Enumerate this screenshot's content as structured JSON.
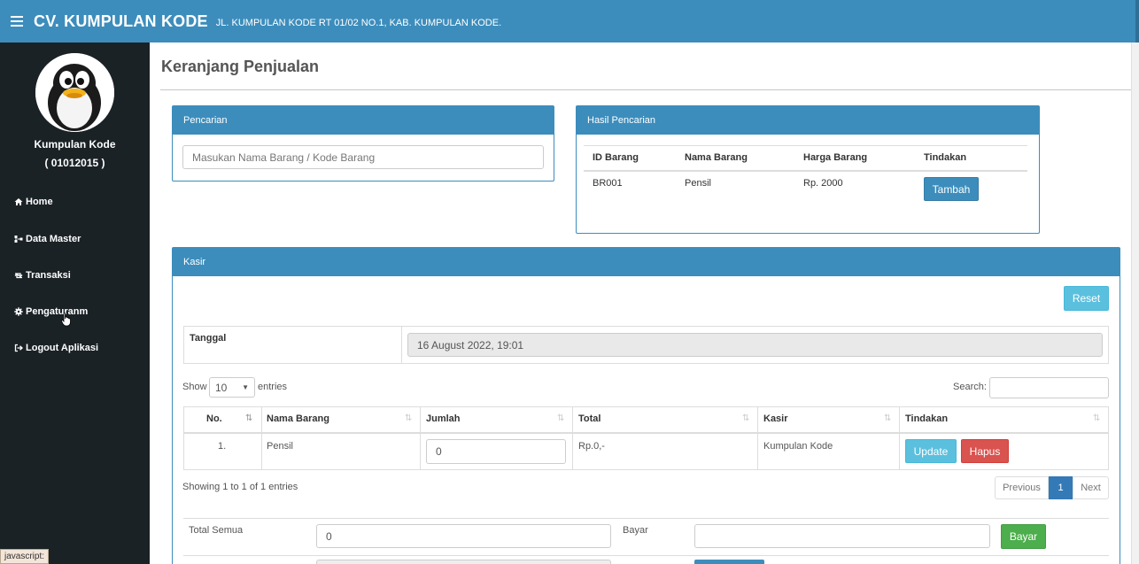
{
  "header": {
    "brand": "CV. KUMPULAN KODE",
    "address": "JL. KUMPULAN KODE RT 01/02 NO.1, KAB. KUMPULAN KODE."
  },
  "sidebar": {
    "profile_name": "Kumpulan Kode",
    "profile_id": "( 01012015 )",
    "items": [
      {
        "label": "Home",
        "icon": "home-icon"
      },
      {
        "label": "Data Master",
        "icon": "sitemap-icon"
      },
      {
        "label": "Transaksi",
        "icon": "retweet-icon"
      },
      {
        "label": "Pengaturanm",
        "icon": "gear-icon"
      },
      {
        "label": "Logout Aplikasi",
        "icon": "logout-icon"
      }
    ]
  },
  "statusbar": {
    "text": "javascript:"
  },
  "main": {
    "title": "Keranjang Penjualan",
    "pencarian": {
      "title": "Pencarian",
      "placeholder": "Masukan Nama Barang / Kode Barang"
    },
    "hasil": {
      "title": "Hasil Pencarian",
      "columns": [
        "ID Barang",
        "Nama Barang",
        "Harga Barang",
        "Tindakan"
      ],
      "row": {
        "id": "BR001",
        "nama": "Pensil",
        "harga": "Rp. 2000",
        "action": "Tambah"
      }
    },
    "kasir": {
      "title": "Kasir",
      "reset_label": "Reset",
      "tanggal_label": "Tanggal",
      "tanggal_value": "16 August 2022, 19:01",
      "show_label": "Show",
      "entries_value": "10",
      "entries_label": "entries",
      "search_label": "Search:",
      "columns": [
        "No.",
        "Nama Barang",
        "Jumlah",
        "Total",
        "Kasir",
        "Tindakan"
      ],
      "row": {
        "no": "1.",
        "nama": "Pensil",
        "jumlah": "0",
        "total": "Rp.0,-",
        "kasir": "Kumpulan Kode",
        "update": "Update",
        "hapus": "Hapus"
      },
      "info": "Showing 1 to 1 of 1 entries",
      "pager": {
        "previous": "Previous",
        "page": "1",
        "next": "Next"
      },
      "total_semua_label": "Total Semua",
      "total_semua_value": "0",
      "bayar_label": "Bayar",
      "bayar_button": "Bayar"
    }
  },
  "colors": {
    "primary": "#3c8dbc",
    "sidebar": "#1a2226",
    "danger": "#d9534f",
    "info": "#5bc0de",
    "success": "#4cae4c"
  }
}
